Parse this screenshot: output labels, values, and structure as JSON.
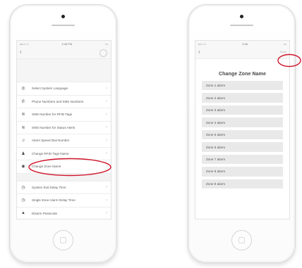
{
  "left_phone": {
    "status": {
      "carrier": "•••○○ ≈",
      "time": "3:48 PM",
      "battery": "▭"
    },
    "menu_group_1": [
      {
        "icon": "globe-icon",
        "glyph": "◎",
        "label": "Select System Language"
      },
      {
        "icon": "phone-icon",
        "glyph": "✆",
        "label": "Phone Numbers and SMS Numbers"
      },
      {
        "icon": "signal-icon",
        "glyph": "≋",
        "label": "SMS Number for RFID Tags"
      },
      {
        "icon": "signal-icon",
        "glyph": "≋",
        "label": "SMS Number for Status Alerts"
      },
      {
        "icon": "bell-icon",
        "glyph": "♫",
        "label": "Alarm Speed Dial Number"
      },
      {
        "icon": "user-icon",
        "glyph": "♟",
        "label": "Change RFID Tags Name"
      },
      {
        "icon": "zone-icon",
        "glyph": "◉",
        "label": "Change Zone Name"
      }
    ],
    "menu_group_2": [
      {
        "icon": "clock-icon",
        "glyph": "◷",
        "label": "System Exit Delay Time"
      },
      {
        "icon": "clock-icon",
        "glyph": "◷",
        "label": "Single Zone Alarm Delay Time"
      },
      {
        "icon": "lock-icon",
        "glyph": "▲",
        "label": "Disarm Passcode"
      }
    ]
  },
  "right_phone": {
    "status": {
      "carrier": "••○○ ≈",
      "time": "3:48",
      "battery": "▭"
    },
    "nav_action": "Save",
    "title": "Change Zone Name",
    "zones": [
      "Zone 1 alarm",
      "Zone 2 alarm",
      "Zone 3 alarm",
      "Zone 4 alarm",
      "Zone 5 alarm",
      "Zone 6 alarm",
      "Zone 7 alarm",
      "Zone 8 alarm",
      "Zone 9 alarm"
    ]
  },
  "colors": {
    "highlight": "#d0142a",
    "row": "#e9e9e9"
  }
}
